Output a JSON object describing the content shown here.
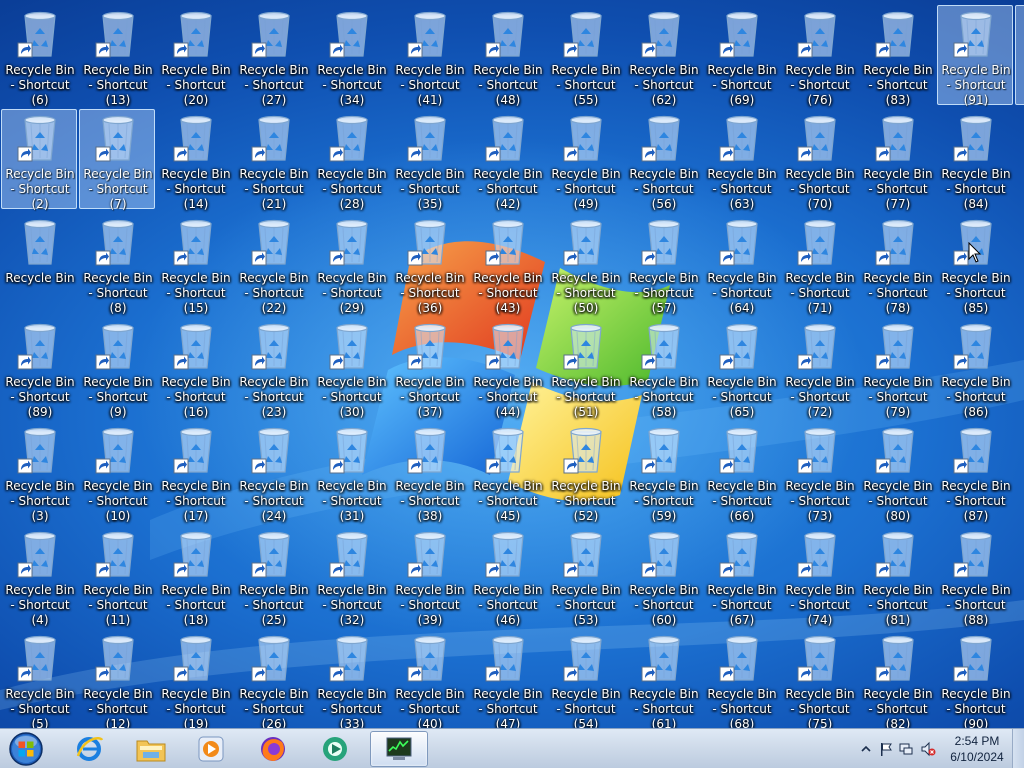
{
  "desktop": {
    "icon_labels": {
      "recycle_bin": "Recycle Bin",
      "shortcut_prefix": "Recycle Bin - Shortcut"
    },
    "grid": {
      "rows": [
        [
          "Recycle Bin - Shortcut (6)",
          "Recycle Bin - Shortcut (13)",
          "Recycle Bin - Shortcut (20)",
          "Recycle Bin - Shortcut (27)",
          "Recycle Bin - Shortcut (34)",
          "Recycle Bin - Shortcut (41)",
          "Recycle Bin - Shortcut (48)",
          "Recycle Bin - Shortcut (55)",
          "Recycle Bin - Shortcut (62)",
          "Recycle Bin - Shortcut (69)",
          "Recycle Bin - Shortcut (76)",
          "Recycle Bin - Shortcut (83)",
          "Recycle Bin - Shortcut (91)"
        ],
        [
          "Recycle Bin - Shortcut (2)",
          "Recycle Bin - Shortcut (7)",
          "Recycle Bin - Shortcut (14)",
          "Recycle Bin - Shortcut (21)",
          "Recycle Bin - Shortcut (28)",
          "Recycle Bin - Shortcut (35)",
          "Recycle Bin - Shortcut (42)",
          "Recycle Bin - Shortcut (49)",
          "Recycle Bin - Shortcut (56)",
          "Recycle Bin - Shortcut (63)",
          "Recycle Bin - Shortcut (70)",
          "Recycle Bin - Shortcut (77)",
          "Recycle Bin - Shortcut (84)"
        ],
        [
          "Recycle Bin",
          "Recycle Bin - Shortcut (8)",
          "Recycle Bin - Shortcut (15)",
          "Recycle Bin - Shortcut (22)",
          "Recycle Bin - Shortcut (29)",
          "Recycle Bin - Shortcut (36)",
          "Recycle Bin - Shortcut (43)",
          "Recycle Bin - Shortcut (50)",
          "Recycle Bin - Shortcut (57)",
          "Recycle Bin - Shortcut (64)",
          "Recycle Bin - Shortcut (71)",
          "Recycle Bin - Shortcut (78)",
          "Recycle Bin - Shortcut (85)"
        ],
        [
          "Recycle Bin - Shortcut (89)",
          "Recycle Bin - Shortcut (9)",
          "Recycle Bin - Shortcut (16)",
          "Recycle Bin - Shortcut (23)",
          "Recycle Bin - Shortcut (30)",
          "Recycle Bin - Shortcut (37)",
          "Recycle Bin - Shortcut (44)",
          "Recycle Bin - Shortcut (51)",
          "Recycle Bin - Shortcut (58)",
          "Recycle Bin - Shortcut (65)",
          "Recycle Bin - Shortcut (72)",
          "Recycle Bin - Shortcut (79)",
          "Recycle Bin - Shortcut (86)"
        ],
        [
          "Recycle Bin - Shortcut (3)",
          "Recycle Bin - Shortcut (10)",
          "Recycle Bin - Shortcut (17)",
          "Recycle Bin - Shortcut (24)",
          "Recycle Bin - Shortcut (31)",
          "Recycle Bin - Shortcut (38)",
          "Recycle Bin - Shortcut (45)",
          "Recycle Bin - Shortcut (52)",
          "Recycle Bin - Shortcut (59)",
          "Recycle Bin - Shortcut (66)",
          "Recycle Bin - Shortcut (73)",
          "Recycle Bin - Shortcut (80)",
          "Recycle Bin - Shortcut (87)"
        ],
        [
          "Recycle Bin - Shortcut (4)",
          "Recycle Bin - Shortcut (11)",
          "Recycle Bin - Shortcut (18)",
          "Recycle Bin - Shortcut (25)",
          "Recycle Bin - Shortcut (32)",
          "Recycle Bin - Shortcut (39)",
          "Recycle Bin - Shortcut (46)",
          "Recycle Bin - Shortcut (53)",
          "Recycle Bin - Shortcut (60)",
          "Recycle Bin - Shortcut (67)",
          "Recycle Bin - Shortcut (74)",
          "Recycle Bin - Shortcut (81)",
          "Recycle Bin - Shortcut (88)"
        ],
        [
          "Recycle Bin - Shortcut (5)",
          "Recycle Bin - Shortcut (12)",
          "Recycle Bin - Shortcut (19)",
          "Recycle Bin - Shortcut (26)",
          "Recycle Bin - Shortcut (33)",
          "Recycle Bin - Shortcut (40)",
          "Recycle Bin - Shortcut (47)",
          "Recycle Bin - Shortcut (54)",
          "Recycle Bin - Shortcut (61)",
          "Recycle Bin - Shortcut (68)",
          "Recycle Bin - Shortcut (75)",
          "Recycle Bin - Shortcut (82)",
          "Recycle Bin - Shortcut (90)"
        ]
      ],
      "selected": [
        "Recycle Bin - Shortcut (91)",
        "Recycle Bin - Shortcut (2)",
        "Recycle Bin - Shortcut (7)"
      ],
      "partial_column_visible": true
    },
    "wallpaper": "windows-7-default-logo"
  },
  "taskbar": {
    "start_button": {
      "icon": "windows-orb-icon"
    },
    "pinned": [
      {
        "name": "internet-explorer",
        "icon": "internet-explorer-icon",
        "active": false
      },
      {
        "name": "windows-explorer",
        "icon": "folder-icon",
        "active": false
      },
      {
        "name": "windows-media-player",
        "icon": "media-player-icon",
        "active": false
      },
      {
        "name": "firefox",
        "icon": "firefox-icon",
        "active": false
      },
      {
        "name": "app",
        "icon": "green-app-icon",
        "active": false
      },
      {
        "name": "task-manager",
        "icon": "task-manager-icon",
        "active": true
      }
    ],
    "tray": {
      "icons": [
        "show-hidden-icons-arrow-icon",
        "action-center-flag-icon",
        "network-icon",
        "volume-muted-icon"
      ],
      "clock": {
        "time": "2:54 PM",
        "date": "6/10/2024"
      }
    }
  },
  "colors": {
    "taskbar": "#cfdbea",
    "desktop_blue": "#1b6fd0",
    "selection": "#c8e1ff"
  }
}
